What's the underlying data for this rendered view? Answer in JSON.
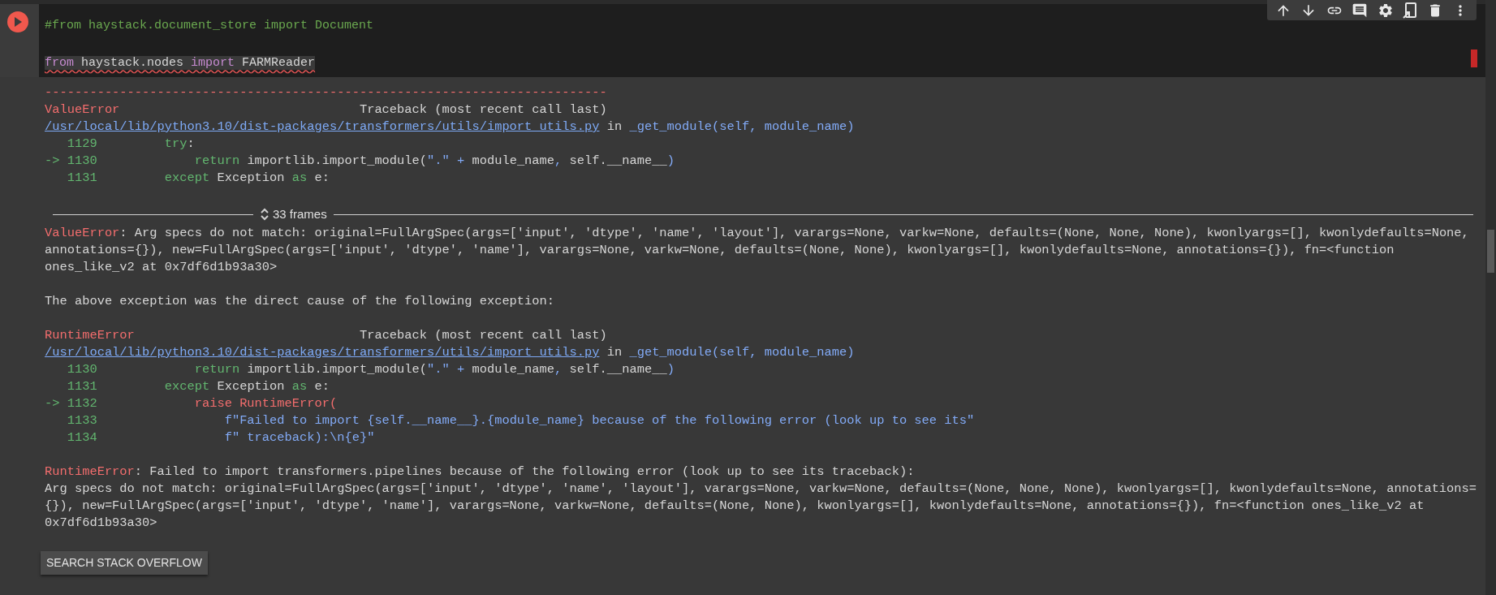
{
  "code_cell": {
    "lines": [
      {
        "kind": "code",
        "segments": [
          {
            "kind": "comment",
            "text": "#from haystack.document_store import Document"
          }
        ]
      },
      {
        "kind": "gap"
      },
      {
        "kind": "code",
        "warning": true,
        "segments": [
          {
            "kind": "import",
            "text": "from"
          },
          {
            "kind": "plain",
            "text": " haystack.nodes "
          },
          {
            "kind": "import",
            "text": "import"
          },
          {
            "kind": "plain",
            "text": " FARMReader"
          }
        ]
      }
    ]
  },
  "output": {
    "lines": [
      {
        "kind": "text",
        "segments": [
          {
            "kind": "error",
            "text": "---------------------------------------------------------------------------"
          }
        ]
      },
      {
        "kind": "text",
        "segments": [
          {
            "kind": "error",
            "text": "ValueError"
          },
          {
            "kind": "plain",
            "text": "                                Traceback (most recent call last)"
          }
        ]
      },
      {
        "kind": "link",
        "path": "/usr/local/lib/python3.10/dist-packages/transformers/utils/import_utils.py",
        "segments": [
          {
            "kind": "plain",
            "text": " in "
          },
          {
            "kind": "string",
            "text": "_get_module(self, module_name)"
          }
        ]
      },
      {
        "kind": "text",
        "segments": [
          {
            "kind": "lineno",
            "text": "   1129"
          },
          {
            "kind": "keyword",
            "text": "         try"
          },
          {
            "kind": "plain",
            "text": ":"
          }
        ]
      },
      {
        "kind": "text",
        "segments": [
          {
            "kind": "lineno",
            "text": "-> 1130"
          },
          {
            "kind": "keyword",
            "text": "             return"
          },
          {
            "kind": "plain",
            "text": " importlib.import_module("
          },
          {
            "kind": "string",
            "text": "\".\" + "
          },
          {
            "kind": "plain",
            "text": "module_name"
          },
          {
            "kind": "string",
            "text": ", "
          },
          {
            "kind": "plain",
            "text": "self.__name__"
          },
          {
            "kind": "string",
            "text": ")"
          }
        ]
      },
      {
        "kind": "text",
        "segments": [
          {
            "kind": "lineno",
            "text": "   1131"
          },
          {
            "kind": "keyword",
            "text": "         except"
          },
          {
            "kind": "plain",
            "text": " Exception "
          },
          {
            "kind": "keyword",
            "text": "as"
          },
          {
            "kind": "plain",
            "text": " e:"
          }
        ]
      },
      {
        "kind": "gap"
      },
      {
        "kind": "frames",
        "label": "33 frames"
      },
      {
        "kind": "text",
        "segments": [
          {
            "kind": "error",
            "text": "ValueError"
          },
          {
            "kind": "plain",
            "text": ": Arg specs do not match: original=FullArgSpec(args=['input', 'dtype', 'name', 'layout'], varargs=None, varkw=None, defaults=(None, None, None), kwonlyargs=[], kwonlydefaults=None,"
          }
        ]
      },
      {
        "kind": "text",
        "segments": [
          {
            "kind": "plain",
            "text": "annotations={}), new=FullArgSpec(args=['input', 'dtype', 'name'], varargs=None, varkw=None, defaults=(None, None), kwonlyargs=[], kwonlydefaults=None, annotations={}), fn=<function"
          }
        ]
      },
      {
        "kind": "text",
        "segments": [
          {
            "kind": "plain",
            "text": "ones_like_v2 at 0x7df6d1b93a30>"
          }
        ]
      },
      {
        "kind": "gap"
      },
      {
        "kind": "text",
        "segments": [
          {
            "kind": "plain",
            "text": "The above exception was the direct cause of the following exception:"
          }
        ]
      },
      {
        "kind": "gap"
      },
      {
        "kind": "text",
        "segments": [
          {
            "kind": "error",
            "text": "RuntimeError"
          },
          {
            "kind": "plain",
            "text": "                              Traceback (most recent call last)"
          }
        ]
      },
      {
        "kind": "link",
        "path": "/usr/local/lib/python3.10/dist-packages/transformers/utils/import_utils.py",
        "segments": [
          {
            "kind": "plain",
            "text": " in "
          },
          {
            "kind": "string",
            "text": "_get_module(self, module_name)"
          }
        ]
      },
      {
        "kind": "text",
        "segments": [
          {
            "kind": "lineno",
            "text": "   1130"
          },
          {
            "kind": "keyword",
            "text": "             return"
          },
          {
            "kind": "plain",
            "text": " importlib.import_module("
          },
          {
            "kind": "string",
            "text": "\".\" + "
          },
          {
            "kind": "plain",
            "text": "module_name"
          },
          {
            "kind": "string",
            "text": ", "
          },
          {
            "kind": "plain",
            "text": "self.__name__"
          },
          {
            "kind": "string",
            "text": ")"
          }
        ]
      },
      {
        "kind": "text",
        "segments": [
          {
            "kind": "lineno",
            "text": "   1131"
          },
          {
            "kind": "keyword",
            "text": "         except"
          },
          {
            "kind": "plain",
            "text": " Exception "
          },
          {
            "kind": "keyword",
            "text": "as"
          },
          {
            "kind": "plain",
            "text": " e:"
          }
        ]
      },
      {
        "kind": "text",
        "segments": [
          {
            "kind": "lineno",
            "text": "-> 1132"
          },
          {
            "kind": "error",
            "text": "             raise RuntimeError("
          }
        ]
      },
      {
        "kind": "text",
        "segments": [
          {
            "kind": "lineno",
            "text": "   1133"
          },
          {
            "kind": "string",
            "text": "                 f\"Failed to import {self.__name__}.{module_name} because of the following error (look up to see its\""
          }
        ]
      },
      {
        "kind": "text",
        "segments": [
          {
            "kind": "lineno",
            "text": "   1134"
          },
          {
            "kind": "string",
            "text": "                 f\" traceback):\\n{e}\""
          }
        ]
      },
      {
        "kind": "gap"
      },
      {
        "kind": "text",
        "segments": [
          {
            "kind": "error",
            "text": "RuntimeError"
          },
          {
            "kind": "plain",
            "text": ": Failed to import transformers.pipelines because of the following error (look up to see its traceback):"
          }
        ]
      },
      {
        "kind": "text",
        "segments": [
          {
            "kind": "plain",
            "text": "Arg specs do not match: original=FullArgSpec(args=['input', 'dtype', 'name', 'layout'], varargs=None, varkw=None, defaults=(None, None, None), kwonlyargs=[], kwonlydefaults=None, annotations="
          }
        ]
      },
      {
        "kind": "text",
        "segments": [
          {
            "kind": "plain",
            "text": "{}), new=FullArgSpec(args=['input', 'dtype', 'name'], varargs=None, varkw=None, defaults=(None, None), kwonlyargs=[], kwonlydefaults=None, annotations={}), fn=<function ones_like_v2 at"
          }
        ]
      },
      {
        "kind": "text",
        "segments": [
          {
            "kind": "plain",
            "text": "0x7df6d1b93a30>"
          }
        ]
      }
    ],
    "button": "SEARCH STACK OVERFLOW"
  }
}
